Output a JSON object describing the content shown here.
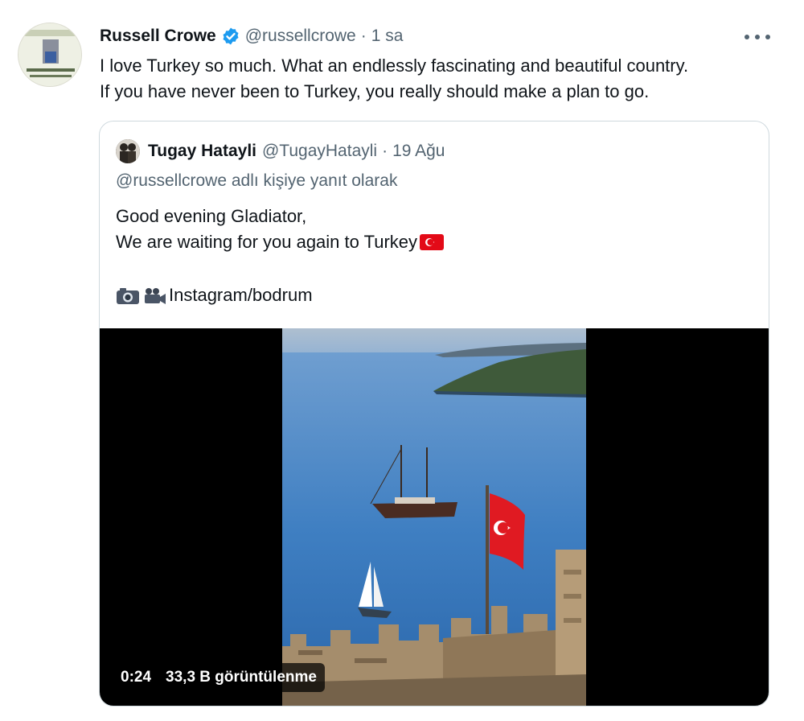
{
  "tweet": {
    "author_name": "Russell Crowe",
    "author_handle": "@russellcrowe",
    "separator": "·",
    "time": "1 sa",
    "verified_icon": "verified-badge-icon",
    "more_icon": "more-options-icon",
    "text_lines": [
      "I love Turkey so much. What an endlessly fascinating and beautiful country.",
      "If you have never been to Turkey, you really should make a plan to go."
    ]
  },
  "quote": {
    "author_name": "Tugay Hatayli",
    "author_handle": "@TugayHatayli",
    "separator": "·",
    "time": "19 Ağu",
    "reply_context": "@russellcrowe adlı kişiye yanıt olarak",
    "text_line1": "Good evening Gladiator,",
    "text_line2": "We are waiting for you again to Turkey",
    "credit": "Instagram/bodrum",
    "emojis": [
      "turkey-flag-emoji",
      "camera-emoji",
      "video-camera-emoji"
    ],
    "video": {
      "duration": "0:24",
      "views": "33,3 B görüntülenme"
    }
  },
  "colors": {
    "text_primary": "#0f1419",
    "text_secondary": "#536471",
    "verified_blue": "#1d9bf0",
    "border": "#cfd9de",
    "flag_red": "#e30a17"
  }
}
